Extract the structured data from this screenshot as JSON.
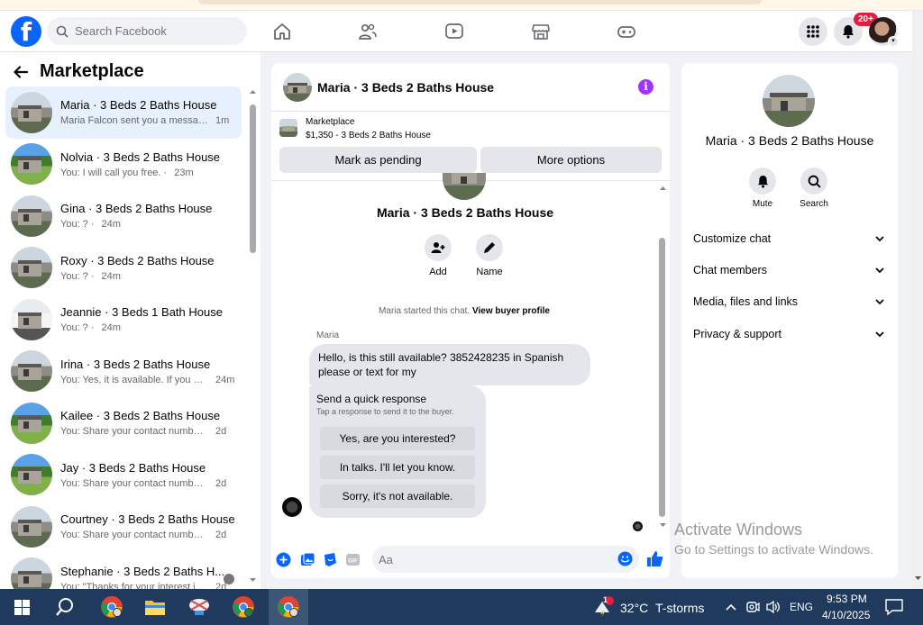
{
  "header": {
    "search_placeholder": "Search Facebook",
    "notification_badge": "20+"
  },
  "sidebar": {
    "title": "Marketplace",
    "conversations": [
      {
        "name": "Maria · 3 Beds 2 Baths House",
        "preview": "Maria Falcon sent you a message ...",
        "time": "1m",
        "active": true
      },
      {
        "name": "Nolvia · 3 Beds 2 Baths House",
        "preview": "You: I will call you free. ·",
        "time": "23m"
      },
      {
        "name": "Gina · 3 Beds 2 Baths House",
        "preview": "You: ? ·",
        "time": "24m"
      },
      {
        "name": "Roxy · 3 Beds 2 Baths House",
        "preview": "You: ? ·",
        "time": "24m"
      },
      {
        "name": "Jeannie · 3 Beds 1 Bath House",
        "preview": "You: ? ·",
        "time": "24m"
      },
      {
        "name": "Irina · 3 Beds 2 Baths House",
        "preview": "You: Yes, it is available. If you are ...",
        "time": "24m"
      },
      {
        "name": "Kailee · 3 Beds 2 Baths House",
        "preview": "You: Share your contact number a...",
        "time": "2d"
      },
      {
        "name": "Jay · 3 Beds 2 Baths House",
        "preview": "You: Share your contact number a...",
        "time": "2d"
      },
      {
        "name": "Courtney · 3 Beds 2 Baths House",
        "preview": "You: Share your contact number a...",
        "time": "2d"
      },
      {
        "name": "Stephanie · 3 Beds 2 Baths H...",
        "preview": "You: \"Thanks for your interest in...",
        "time": "2d"
      }
    ]
  },
  "chat": {
    "title": "Maria · 3 Beds 2 Baths House",
    "listing": {
      "source": "Marketplace",
      "price_title": "$1,350 - 3 Beds 2 Baths House",
      "pending_label": "Mark as pending",
      "more_label": "More options"
    },
    "body_title": "Maria · 3 Beds 2 Baths House",
    "add_label": "Add",
    "name_label": "Name",
    "started_text": "Maria started this chat.",
    "view_profile": "View buyer profile",
    "sender": "Maria",
    "message": "Hello, is this still available? 3852428235 in Spanish please or text for my",
    "quick": {
      "title": "Send a quick response",
      "subtitle": "Tap a response to send it to the buyer.",
      "options": [
        "Yes, are you interested?",
        "In talks. I'll let you know.",
        "Sorry, it's not available."
      ]
    },
    "composer_placeholder": "Aa"
  },
  "details": {
    "name": "Maria · 3 Beds 2 Baths House",
    "mute_label": "Mute",
    "search_label": "Search",
    "sections": [
      "Customize chat",
      "Chat members",
      "Media, files and links",
      "Privacy & support"
    ]
  },
  "watermark": {
    "line1": "Activate Windows",
    "line2": "Go to Settings to activate Windows."
  },
  "taskbar": {
    "weather_temp": "32°C",
    "weather_desc": "T-storms",
    "weather_badge": "1",
    "language": "ENG",
    "time": "9:53 PM",
    "date": "4/10/2025"
  },
  "colors": {
    "brand": "#0866ff",
    "info": "#a033ff",
    "badge": "#e41e3f",
    "taskbar": "#1f3a5c"
  }
}
